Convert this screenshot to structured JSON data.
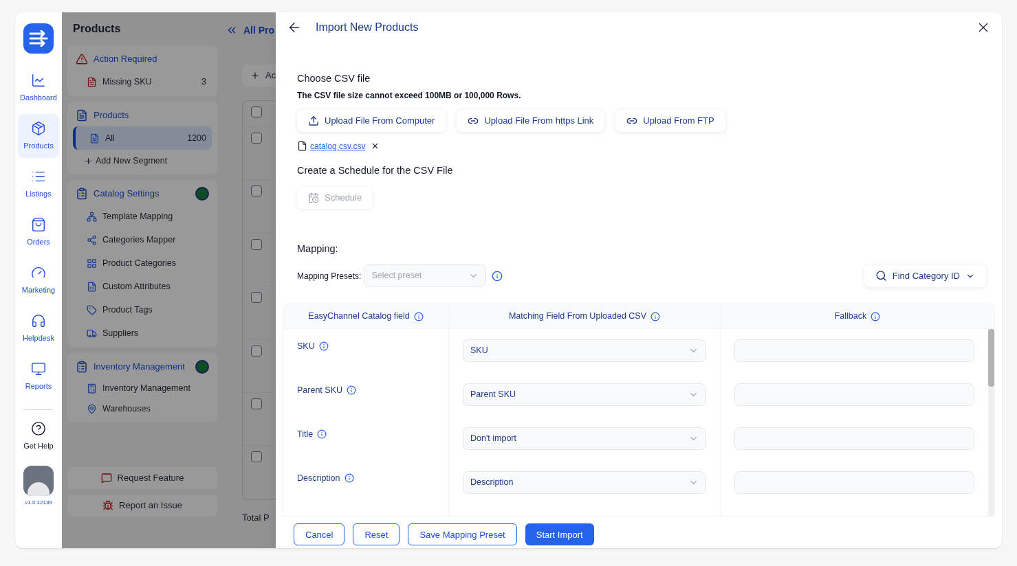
{
  "rail": {
    "items": [
      {
        "label": "Dashboard",
        "selected": false
      },
      {
        "label": "Products",
        "selected": true
      },
      {
        "label": "Listings",
        "selected": false
      },
      {
        "label": "Orders",
        "selected": false
      },
      {
        "label": "Marketing",
        "selected": false
      },
      {
        "label": "Helpdesk",
        "selected": false
      },
      {
        "label": "Reports",
        "selected": false
      }
    ],
    "help": "Get Help",
    "version": "v1.0.12139"
  },
  "products_panel": {
    "title": "Products",
    "groups": [
      {
        "kind": "alert",
        "title": "Action Required",
        "beta": false,
        "items": [
          {
            "label": "Missing SKU",
            "count": "3",
            "selected": false
          }
        ]
      },
      {
        "kind": "list",
        "title": "Products",
        "beta": false,
        "items": [
          {
            "label": "All",
            "count": "1200",
            "selected": true
          }
        ],
        "add_link": "Add New Segment"
      },
      {
        "kind": "settings",
        "title": "Catalog Settings",
        "beta": true,
        "items": [
          {
            "label": "Template Mapping",
            "selected": false
          },
          {
            "label": "Categories Mapper",
            "selected": false
          },
          {
            "label": "Product Categories",
            "selected": false
          },
          {
            "label": "Custom Attributes",
            "selected": false
          },
          {
            "label": "Product Tags",
            "selected": false
          },
          {
            "label": "Suppliers",
            "selected": false
          }
        ]
      },
      {
        "kind": "settings",
        "title": "Inventory Management",
        "beta": true,
        "items": [
          {
            "label": "Inventory Management",
            "selected": false
          },
          {
            "label": "Warehouses",
            "selected": false
          }
        ]
      }
    ],
    "footer_buttons": [
      "Request Feature",
      "Report an Issue"
    ]
  },
  "background": {
    "title": "All Pro",
    "add_button": "Ac",
    "checkboxes": [
      {
        "checked": false
      },
      {
        "checked": false
      },
      {
        "checked": false
      },
      {
        "checked": false
      },
      {
        "checked": false
      },
      {
        "checked": false
      },
      {
        "checked": false
      },
      {
        "checked": false
      }
    ],
    "total": "Total P"
  },
  "modal": {
    "title": "Import New Products",
    "choose_heading": "Choose CSV file",
    "note": "The CSV file size cannot exceed 100MB or 100,000 Rows.",
    "upload_buttons": [
      {
        "kind": "upload",
        "label": "Upload File From Computer"
      },
      {
        "kind": "link",
        "label": "Upload File From https Link"
      },
      {
        "kind": "link",
        "label": "Upload From FTP"
      }
    ],
    "file": "catalog csv.csv",
    "schedule_heading": "Create a Schedule for the CSV File",
    "schedule_button": {
      "label": "Schedule",
      "disabled": true
    },
    "mapping_heading": "Mapping:",
    "presets_label": "Mapping Presets:",
    "presets_placeholder": "Select preset",
    "find_category": "Find Category ID",
    "columns": [
      "EasyChannel Catalog field",
      "Matching Field From Uploaded CSV",
      "Fallback"
    ],
    "rows": [
      {
        "field": "SKU",
        "match": "SKU"
      },
      {
        "field": "Parent SKU",
        "match": "Parent SKU"
      },
      {
        "field": "Title",
        "match": "Don't import"
      },
      {
        "field": "Description",
        "match": "Description"
      }
    ],
    "footer_buttons": [
      {
        "kind": "outline",
        "label": "Cancel"
      },
      {
        "kind": "outline",
        "label": "Reset"
      },
      {
        "kind": "outline",
        "label": "Save Mapping Preset"
      },
      {
        "kind": "primary",
        "label": "Start Import"
      }
    ]
  }
}
